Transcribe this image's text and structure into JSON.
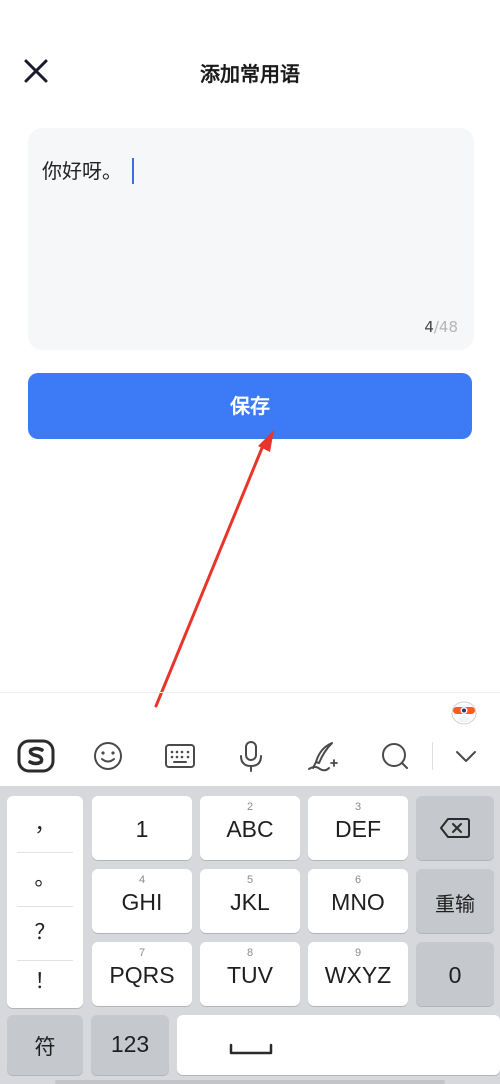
{
  "header": {
    "title": "添加常用语"
  },
  "editor": {
    "text": "你好呀。",
    "count_current": "4",
    "count_max": "/48"
  },
  "save_button": {
    "label": "保存"
  },
  "ime": {
    "toolbar": [
      "sogou-logo-icon",
      "emoji-icon",
      "keyboard-icon",
      "microphone-icon",
      "handwriting-icon",
      "search-icon",
      "chevron-down-icon"
    ],
    "punctuation": [
      "，",
      "。",
      "？",
      "！"
    ],
    "keys": {
      "k1": {
        "label": "1",
        "hint": ""
      },
      "k2": {
        "label": "ABC",
        "hint": "2"
      },
      "k3": {
        "label": "DEF",
        "hint": "3"
      },
      "k4": {
        "label": "GHI",
        "hint": "4"
      },
      "k5": {
        "label": "JKL",
        "hint": "5"
      },
      "k6": {
        "label": "MNO",
        "hint": "6"
      },
      "k7": {
        "label": "PQRS",
        "hint": "7"
      },
      "k8": {
        "label": "TUV",
        "hint": "8"
      },
      "k9": {
        "label": "WXYZ",
        "hint": "9"
      }
    },
    "reenter_label": "重输",
    "zero_label": "0",
    "symbol_label": "符",
    "num_label": "123"
  },
  "colors": {
    "accent": "#3d7af5",
    "arrow": "#e8352b",
    "caret": "#3b6fe8",
    "keyboard_bg": "#d6d8db"
  }
}
